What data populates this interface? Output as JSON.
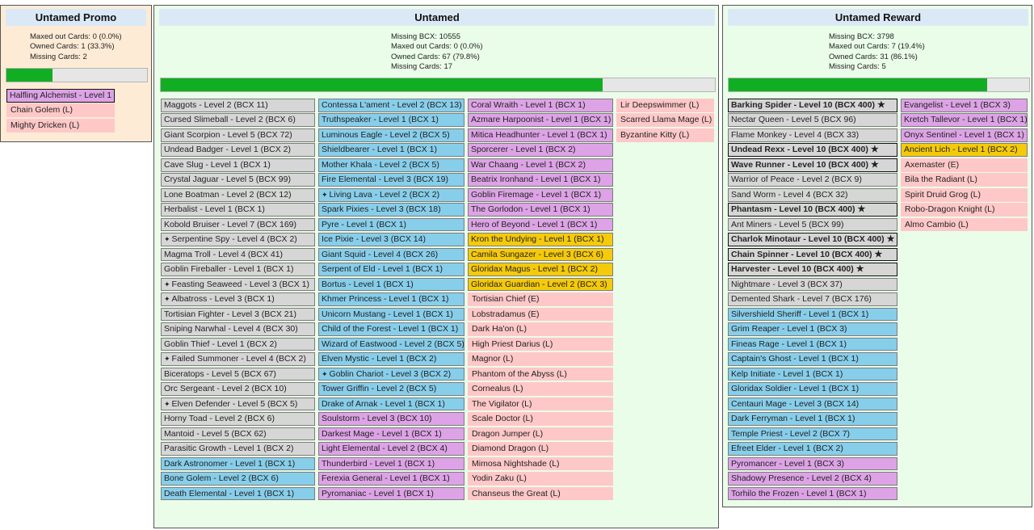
{
  "panels": [
    {
      "title": "Untamed Promo",
      "bg": "#fdebd6",
      "stats": [
        "Maxed out Cards: 0 (0.0%)",
        "Owned Cards: 1 (33.3%)",
        "Missing Cards: 2"
      ],
      "progress": 0.33,
      "columns": [
        [
          {
            "label": "Halfling Alchemist - Level 1",
            "rarity": "epic",
            "state": "maxed"
          },
          {
            "label": "Chain Golem (L)",
            "rarity": "missing",
            "state": "missing"
          },
          {
            "label": "Mighty Dricken (L)",
            "rarity": "missing",
            "state": "missing"
          }
        ]
      ]
    },
    {
      "title": "Untamed",
      "bg": "#eafde9",
      "stats": [
        "Missing BCX: 10555",
        "Maxed out Cards: 0 (0.0%)",
        "Owned Cards: 67 (79.8%)",
        "Missing Cards: 17"
      ],
      "progress": 0.798,
      "columns": [
        [
          {
            "label": "Maggots - Level 2 (BCX 11)",
            "rarity": "common",
            "state": "owned"
          },
          {
            "label": "Cursed Slimeball - Level 2 (BCX 6)",
            "rarity": "common",
            "state": "owned"
          },
          {
            "label": "Giant Scorpion - Level 5 (BCX 72)",
            "rarity": "common",
            "state": "owned"
          },
          {
            "label": "Undead Badger - Level 1 (BCX 2)",
            "rarity": "common",
            "state": "owned"
          },
          {
            "label": "Cave Slug - Level 1 (BCX 1)",
            "rarity": "common",
            "state": "owned"
          },
          {
            "label": "Crystal Jaguar - Level 5 (BCX 99)",
            "rarity": "common",
            "state": "owned"
          },
          {
            "label": "Lone Boatman - Level 2 (BCX 12)",
            "rarity": "common",
            "state": "owned"
          },
          {
            "label": "Herbalist - Level 1 (BCX 1)",
            "rarity": "common",
            "state": "owned"
          },
          {
            "label": "Kobold Bruiser - Level 7 (BCX 169)",
            "rarity": "common",
            "state": "owned"
          },
          {
            "label": "Serpentine Spy - Level 4 (BCX 2)",
            "rarity": "common",
            "state": "owned",
            "gold": true
          },
          {
            "label": "Magma Troll - Level 4 (BCX 41)",
            "rarity": "common",
            "state": "owned"
          },
          {
            "label": "Goblin Fireballer - Level 1 (BCX 1)",
            "rarity": "common",
            "state": "owned"
          },
          {
            "label": "Feasting Seaweed - Level 3 (BCX 1)",
            "rarity": "common",
            "state": "owned",
            "gold": true
          },
          {
            "label": "Albatross - Level 3 (BCX 1)",
            "rarity": "common",
            "state": "owned",
            "gold": true
          },
          {
            "label": "Tortisian Fighter - Level 3 (BCX 21)",
            "rarity": "common",
            "state": "owned"
          },
          {
            "label": "Sniping Narwhal - Level 4 (BCX 30)",
            "rarity": "common",
            "state": "owned"
          },
          {
            "label": "Goblin Thief - Level 1 (BCX 2)",
            "rarity": "common",
            "state": "owned"
          },
          {
            "label": "Failed Summoner - Level 4 (BCX 2)",
            "rarity": "common",
            "state": "owned",
            "gold": true
          },
          {
            "label": "Biceratops - Level 5 (BCX 67)",
            "rarity": "common",
            "state": "owned"
          },
          {
            "label": "Orc Sergeant - Level 2 (BCX 10)",
            "rarity": "common",
            "state": "owned"
          },
          {
            "label": "Elven Defender - Level 5 (BCX 5)",
            "rarity": "common",
            "state": "owned",
            "gold": true
          },
          {
            "label": "Horny Toad - Level 2 (BCX 6)",
            "rarity": "common",
            "state": "owned"
          },
          {
            "label": "Mantoid - Level 5 (BCX 62)",
            "rarity": "common",
            "state": "owned"
          },
          {
            "label": "Parasitic Growth - Level 1 (BCX 2)",
            "rarity": "common",
            "state": "owned"
          },
          {
            "label": "Dark Astronomer - Level 1 (BCX 1)",
            "rarity": "rare",
            "state": "owned"
          },
          {
            "label": "Bone Golem - Level 2 (BCX 6)",
            "rarity": "rare",
            "state": "owned"
          },
          {
            "label": "Death Elemental - Level 1 (BCX 1)",
            "rarity": "rare",
            "state": "owned"
          }
        ],
        [
          {
            "label": "Contessa L'ament - Level 2 (BCX 13)",
            "rarity": "rare",
            "state": "owned"
          },
          {
            "label": "Truthspeaker - Level 1 (BCX 1)",
            "rarity": "rare",
            "state": "owned"
          },
          {
            "label": "Luminous Eagle - Level 2 (BCX 5)",
            "rarity": "rare",
            "state": "owned"
          },
          {
            "label": "Shieldbearer - Level 1 (BCX 1)",
            "rarity": "rare",
            "state": "owned"
          },
          {
            "label": "Mother Khala - Level 2 (BCX 5)",
            "rarity": "rare",
            "state": "owned"
          },
          {
            "label": "Fire Elemental - Level 3 (BCX 19)",
            "rarity": "rare",
            "state": "owned"
          },
          {
            "label": "Living Lava - Level 2 (BCX 2)",
            "rarity": "rare",
            "state": "owned",
            "gold": true
          },
          {
            "label": "Spark Pixies - Level 3 (BCX 18)",
            "rarity": "rare",
            "state": "owned"
          },
          {
            "label": "Pyre - Level 1 (BCX 1)",
            "rarity": "rare",
            "state": "owned"
          },
          {
            "label": "Ice Pixie - Level 3 (BCX 14)",
            "rarity": "rare",
            "state": "owned"
          },
          {
            "label": "Giant Squid - Level 4 (BCX 26)",
            "rarity": "rare",
            "state": "owned"
          },
          {
            "label": "Serpent of Eld - Level 1 (BCX 1)",
            "rarity": "rare",
            "state": "owned"
          },
          {
            "label": "Bortus - Level 1 (BCX 1)",
            "rarity": "rare",
            "state": "owned"
          },
          {
            "label": "Khmer Princess - Level 1 (BCX 1)",
            "rarity": "rare",
            "state": "owned"
          },
          {
            "label": "Unicorn Mustang - Level 1 (BCX 1)",
            "rarity": "rare",
            "state": "owned"
          },
          {
            "label": "Child of the Forest - Level 1 (BCX 1)",
            "rarity": "rare",
            "state": "owned"
          },
          {
            "label": "Wizard of Eastwood - Level 2 (BCX 5)",
            "rarity": "rare",
            "state": "owned"
          },
          {
            "label": "Elven Mystic - Level 1 (BCX 2)",
            "rarity": "rare",
            "state": "owned"
          },
          {
            "label": "Goblin Chariot - Level 3 (BCX 2)",
            "rarity": "rare",
            "state": "owned",
            "gold": true
          },
          {
            "label": "Tower Griffin - Level 2 (BCX 5)",
            "rarity": "rare",
            "state": "owned"
          },
          {
            "label": "Drake of Arnak - Level 1 (BCX 1)",
            "rarity": "rare",
            "state": "owned"
          },
          {
            "label": "Soulstorm - Level 3 (BCX 10)",
            "rarity": "epic",
            "state": "owned"
          },
          {
            "label": "Darkest Mage - Level 1 (BCX 1)",
            "rarity": "epic",
            "state": "owned"
          },
          {
            "label": "Light Elemental - Level 2 (BCX 4)",
            "rarity": "epic",
            "state": "owned"
          },
          {
            "label": "Thunderbird - Level 1 (BCX 1)",
            "rarity": "epic",
            "state": "owned"
          },
          {
            "label": "Ferexia General - Level 1 (BCX 1)",
            "rarity": "epic",
            "state": "owned"
          },
          {
            "label": "Pyromaniac - Level 1 (BCX 1)",
            "rarity": "epic",
            "state": "owned"
          }
        ],
        [
          {
            "label": "Coral Wraith - Level 1 (BCX 1)",
            "rarity": "epic",
            "state": "owned"
          },
          {
            "label": "Azmare Harpoonist - Level 1 (BCX 1)",
            "rarity": "epic",
            "state": "owned"
          },
          {
            "label": "Mitica Headhunter - Level 1 (BCX 1)",
            "rarity": "epic",
            "state": "owned"
          },
          {
            "label": "Sporcerer - Level 1 (BCX 2)",
            "rarity": "epic",
            "state": "owned"
          },
          {
            "label": "War Chaang - Level 1 (BCX 2)",
            "rarity": "epic",
            "state": "owned"
          },
          {
            "label": "Beatrix Ironhand - Level 1 (BCX 1)",
            "rarity": "epic",
            "state": "owned"
          },
          {
            "label": "Goblin Firemage - Level 1 (BCX 1)",
            "rarity": "epic",
            "state": "owned"
          },
          {
            "label": "The Gorlodon - Level 1 (BCX 1)",
            "rarity": "epic",
            "state": "owned"
          },
          {
            "label": "Hero of Beyond - Level 1 (BCX 1)",
            "rarity": "epic",
            "state": "owned"
          },
          {
            "label": "Kron the Undying - Level 1 (BCX 1)",
            "rarity": "legendary",
            "state": "owned"
          },
          {
            "label": "Camila Sungazer - Level 3 (BCX 6)",
            "rarity": "legendary",
            "state": "owned"
          },
          {
            "label": "Gloridax Magus - Level 1 (BCX 2)",
            "rarity": "legendary",
            "state": "owned"
          },
          {
            "label": "Gloridax Guardian - Level 2 (BCX 3)",
            "rarity": "legendary",
            "state": "owned"
          },
          {
            "label": "Tortisian Chief (E)",
            "rarity": "missing",
            "state": "missing"
          },
          {
            "label": "Lobstradamus (E)",
            "rarity": "missing",
            "state": "missing"
          },
          {
            "label": "Dark Ha'on (L)",
            "rarity": "missing",
            "state": "missing"
          },
          {
            "label": "High Priest Darius (L)",
            "rarity": "missing",
            "state": "missing"
          },
          {
            "label": "Magnor (L)",
            "rarity": "missing",
            "state": "missing"
          },
          {
            "label": "Phantom of the Abyss (L)",
            "rarity": "missing",
            "state": "missing"
          },
          {
            "label": "Cornealus (L)",
            "rarity": "missing",
            "state": "missing"
          },
          {
            "label": "The Vigilator (L)",
            "rarity": "missing",
            "state": "missing"
          },
          {
            "label": "Scale Doctor (L)",
            "rarity": "missing",
            "state": "missing"
          },
          {
            "label": "Dragon Jumper (L)",
            "rarity": "missing",
            "state": "missing"
          },
          {
            "label": "Diamond Dragon (L)",
            "rarity": "missing",
            "state": "missing"
          },
          {
            "label": "Mimosa Nightshade (L)",
            "rarity": "missing",
            "state": "missing"
          },
          {
            "label": "Yodin Zaku (L)",
            "rarity": "missing",
            "state": "missing"
          },
          {
            "label": "Chanseus the Great (L)",
            "rarity": "missing",
            "state": "missing"
          }
        ],
        [
          {
            "label": "Lir Deepswimmer (L)",
            "rarity": "missing",
            "state": "missing"
          },
          {
            "label": "Scarred Llama Mage (L)",
            "rarity": "missing",
            "state": "missing"
          },
          {
            "label": "Byzantine Kitty (L)",
            "rarity": "missing",
            "state": "missing"
          }
        ]
      ]
    },
    {
      "title": "Untamed Reward",
      "bg": "#eafde9",
      "stats": [
        "Missing BCX: 3798",
        "Maxed out Cards: 7 (19.4%)",
        "Owned Cards: 31 (86.1%)",
        "Missing Cards: 5"
      ],
      "progress": 0.861,
      "columns": [
        [
          {
            "label": "Barking Spider - Level 10 (BCX 400)",
            "rarity": "common",
            "state": "maxed",
            "star": true
          },
          {
            "label": "Nectar Queen - Level 5 (BCX 96)",
            "rarity": "common",
            "state": "owned"
          },
          {
            "label": "Flame Monkey - Level 4 (BCX 33)",
            "rarity": "common",
            "state": "owned"
          },
          {
            "label": "Undead Rexx - Level 10 (BCX 400)",
            "rarity": "common",
            "state": "maxed",
            "star": true
          },
          {
            "label": "Wave Runner - Level 10 (BCX 400)",
            "rarity": "common",
            "state": "maxed",
            "star": true
          },
          {
            "label": "Warrior of Peace - Level 2 (BCX 9)",
            "rarity": "common",
            "state": "owned"
          },
          {
            "label": "Sand Worm - Level 4 (BCX 32)",
            "rarity": "common",
            "state": "owned"
          },
          {
            "label": "Phantasm - Level 10 (BCX 400)",
            "rarity": "common",
            "state": "maxed",
            "star": true
          },
          {
            "label": "Ant Miners - Level 5 (BCX 99)",
            "rarity": "common",
            "state": "owned"
          },
          {
            "label": "Charlok Minotaur - Level 10 (BCX 400)",
            "rarity": "common",
            "state": "maxed",
            "star": true
          },
          {
            "label": "Chain Spinner - Level 10 (BCX 400)",
            "rarity": "common",
            "state": "maxed",
            "star": true
          },
          {
            "label": "Harvester - Level 10 (BCX 400)",
            "rarity": "common",
            "state": "maxed",
            "star": true
          },
          {
            "label": "Nightmare - Level 3 (BCX 37)",
            "rarity": "common",
            "state": "owned"
          },
          {
            "label": "Demented Shark - Level 7 (BCX 176)",
            "rarity": "common",
            "state": "owned"
          },
          {
            "label": "Silvershield Sheriff - Level 1 (BCX 1)",
            "rarity": "rare",
            "state": "owned"
          },
          {
            "label": "Grim Reaper - Level 1 (BCX 3)",
            "rarity": "rare",
            "state": "owned"
          },
          {
            "label": "Fineas Rage - Level 1 (BCX 1)",
            "rarity": "rare",
            "state": "owned"
          },
          {
            "label": "Captain's Ghost - Level 1 (BCX 1)",
            "rarity": "rare",
            "state": "owned"
          },
          {
            "label": "Kelp Initiate - Level 1 (BCX 1)",
            "rarity": "rare",
            "state": "owned"
          },
          {
            "label": "Gloridax Soldier - Level 1 (BCX 1)",
            "rarity": "rare",
            "state": "owned"
          },
          {
            "label": "Centauri Mage - Level 3 (BCX 14)",
            "rarity": "rare",
            "state": "owned"
          },
          {
            "label": "Dark Ferryman - Level 1 (BCX 1)",
            "rarity": "rare",
            "state": "owned"
          },
          {
            "label": "Temple Priest - Level 2 (BCX 7)",
            "rarity": "rare",
            "state": "owned"
          },
          {
            "label": "Efreet Elder - Level 1 (BCX 2)",
            "rarity": "rare",
            "state": "owned"
          },
          {
            "label": "Pyromancer - Level 1 (BCX 3)",
            "rarity": "epic",
            "state": "owned"
          },
          {
            "label": "Shadowy Presence - Level 2 (BCX 4)",
            "rarity": "epic",
            "state": "owned"
          },
          {
            "label": "Torhilo the Frozen - Level 1 (BCX 1)",
            "rarity": "epic",
            "state": "owned"
          }
        ],
        [
          {
            "label": "Evangelist - Level 1 (BCX 3)",
            "rarity": "epic",
            "state": "owned"
          },
          {
            "label": "Kretch Tallevor - Level 1 (BCX 1)",
            "rarity": "epic",
            "state": "owned"
          },
          {
            "label": "Onyx Sentinel - Level 1 (BCX 1)",
            "rarity": "epic",
            "state": "owned"
          },
          {
            "label": "Ancient Lich - Level 1 (BCX 2)",
            "rarity": "legendary",
            "state": "owned"
          },
          {
            "label": "Axemaster (E)",
            "rarity": "missing",
            "state": "missing"
          },
          {
            "label": "Bila the Radiant (L)",
            "rarity": "missing",
            "state": "missing"
          },
          {
            "label": "Spirit Druid Grog (L)",
            "rarity": "missing",
            "state": "missing"
          },
          {
            "label": "Robo-Dragon Knight (L)",
            "rarity": "missing",
            "state": "missing"
          },
          {
            "label": "Almo Cambio (L)",
            "rarity": "missing",
            "state": "missing"
          }
        ]
      ]
    }
  ]
}
